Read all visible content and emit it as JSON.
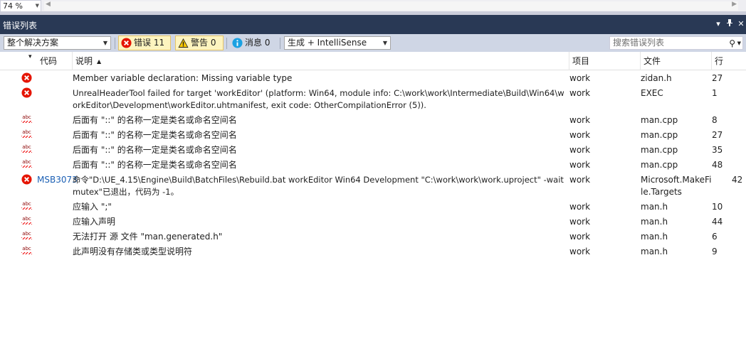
{
  "editor": {
    "zoom": "74 %"
  },
  "panel": {
    "title": "错误列表"
  },
  "toolbar": {
    "scope": "整个解决方案",
    "errors_label": "错误 11",
    "warnings_label": "警告 0",
    "messages_label": "消息 0",
    "build_filter": "生成 + IntelliSense",
    "search_placeholder": "搜索错误列表"
  },
  "columns": {
    "code": "代码",
    "description": "说明",
    "project": "项目",
    "file": "文件",
    "line": "行"
  },
  "rows": [
    {
      "type": "error",
      "code": "",
      "desc": "Member variable declaration: Missing variable type",
      "project": "work",
      "file": "zidan.h",
      "line": "27"
    },
    {
      "type": "error",
      "code": "",
      "desc": "UnrealHeaderTool failed for target 'workEditor' (platform: Win64, module info: C:\\work\\work\\Intermediate\\Build\\Win64\\workEditor\\Development\\workEditor.uhtmanifest, exit code: OtherCompilationError (5)).",
      "project": "work",
      "file": "EXEC",
      "line": "1"
    },
    {
      "type": "intellisense",
      "code": "",
      "desc": "后面有 \"::\" 的名称一定是类名或命名空间名",
      "project": "work",
      "file": "man.cpp",
      "line": "8"
    },
    {
      "type": "intellisense",
      "code": "",
      "desc": "后面有 \"::\" 的名称一定是类名或命名空间名",
      "project": "work",
      "file": "man.cpp",
      "line": "27"
    },
    {
      "type": "intellisense",
      "code": "",
      "desc": "后面有 \"::\" 的名称一定是类名或命名空间名",
      "project": "work",
      "file": "man.cpp",
      "line": "35"
    },
    {
      "type": "intellisense",
      "code": "",
      "desc": "后面有 \"::\" 的名称一定是类名或命名空间名",
      "project": "work",
      "file": "man.cpp",
      "line": "48"
    },
    {
      "type": "error",
      "code": "MSB3073",
      "desc": "命令\"D:\\UE_4.15\\Engine\\Build\\BatchFiles\\Rebuild.bat workEditor Win64 Development \"C:\\work\\work\\work.uproject\" -waitmutex\"已退出，代码为 -1。",
      "project": "work",
      "file": "Microsoft.MakeFile.Targets",
      "line": "42"
    },
    {
      "type": "intellisense",
      "code": "",
      "desc": "应输入 \";\"",
      "project": "work",
      "file": "man.h",
      "line": "10"
    },
    {
      "type": "intellisense",
      "code": "",
      "desc": "应输入声明",
      "project": "work",
      "file": "man.h",
      "line": "44"
    },
    {
      "type": "intellisense",
      "code": "",
      "desc": "无法打开 源 文件 \"man.generated.h\"",
      "project": "work",
      "file": "man.h",
      "line": "6"
    },
    {
      "type": "intellisense",
      "code": "",
      "desc": "此声明没有存储类或类型说明符",
      "project": "work",
      "file": "man.h",
      "line": "9"
    }
  ],
  "colors": {
    "titlebar": "#293955",
    "toolbar": "#cfd6e5",
    "error": "#e51400",
    "code_link": "#1a5fb4"
  }
}
